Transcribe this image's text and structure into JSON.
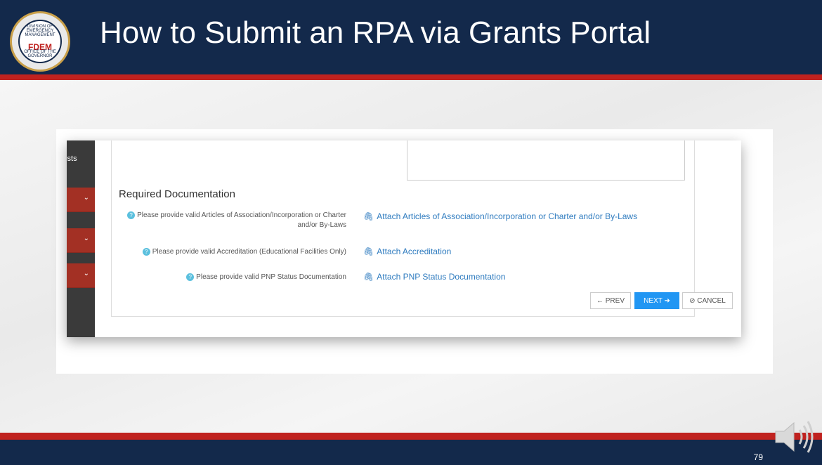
{
  "header": {
    "title": "How to Submit an RPA via Grants Portal",
    "logo_text": "FDEM",
    "logo_top_text": "DIVISION OF EMERGENCY MANAGEMENT",
    "logo_bottom_text": "OFFICE OF THE GOVERNOR"
  },
  "sidebar": {
    "partial_text": "iests",
    "tabs": [
      {
        "icon": "chevron-down-icon",
        "glyph": "⌄"
      },
      {
        "icon": "chevron-down-icon",
        "glyph": "⌄"
      },
      {
        "icon": "chevron-down-icon",
        "glyph": "⌄"
      }
    ]
  },
  "form": {
    "section_title": "Required Documentation",
    "questions": [
      {
        "label": "Please provide valid Articles of Association/Incorporation or Charter and/or By-Laws",
        "attach": "Attach Articles of Association/Incorporation or Charter and/or By-Laws"
      },
      {
        "label": "Please provide valid Accreditation (Educational Facilities Only)",
        "attach": "Attach Accreditation"
      },
      {
        "label": "Please provide valid PNP Status Documentation",
        "attach": "Attach PNP Status Documentation"
      }
    ],
    "buttons": {
      "prev": "← PREV",
      "next": "NEXT ➜",
      "cancel": "⊘ CANCEL"
    }
  },
  "footer": {
    "page_number": "79"
  },
  "colors": {
    "navy": "#13294b",
    "red": "#c0221f",
    "link": "#2e7bbf",
    "primary_button": "#2196f3"
  }
}
